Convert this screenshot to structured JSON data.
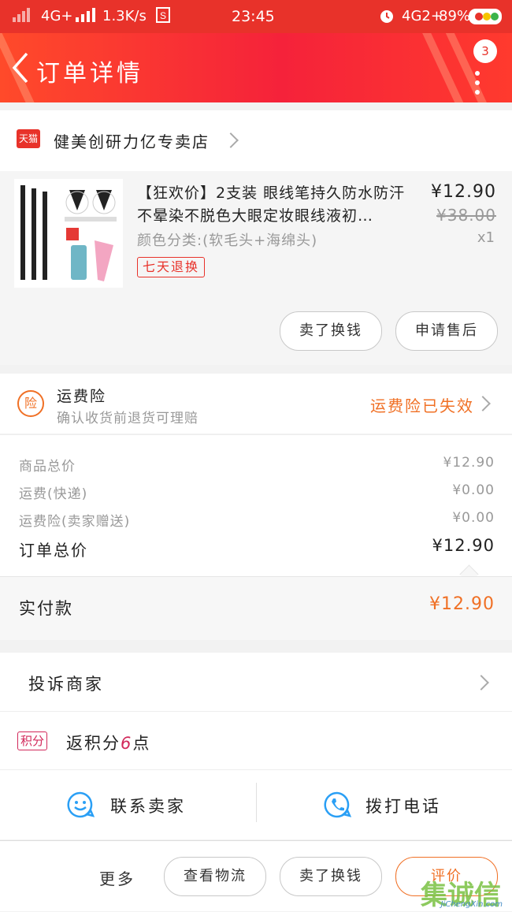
{
  "status_bar": {
    "network_left": "4G+",
    "speed": "1.3K/s",
    "time": "23:45",
    "network_right": "4G2+",
    "battery": "89%"
  },
  "nav": {
    "title": "订单详情",
    "badge_count": "3"
  },
  "shop": {
    "badge": "天猫",
    "name": "健美创研力亿专卖店"
  },
  "product": {
    "title": "【狂欢价】2支装 眼线笔持久防水防汗不晕染不脱色大眼定妆眼线液初…",
    "price": "¥12.90",
    "original_price": "¥38.00",
    "sku": "颜色分类:(软毛头+海绵头)",
    "quantity": "x1",
    "return_tag": "七天退换",
    "btn_refund": "卖了换钱",
    "btn_after_sale": "申请售后"
  },
  "insurance": {
    "icon_char": "险",
    "title": "运费险",
    "subtitle": "确认收货前退货可理赔",
    "status": "运费险已失效"
  },
  "fees": {
    "items": [
      {
        "label": "商品总价",
        "value": "¥12.90"
      },
      {
        "label": "运费(快递)",
        "value": "¥0.00"
      },
      {
        "label": "运费险(卖家赠送)",
        "value": "¥0.00"
      }
    ],
    "total_label": "订单总价",
    "total_value": "¥12.90"
  },
  "payment": {
    "label": "实付款",
    "value": "¥12.90"
  },
  "complaint": {
    "label": "投诉商家"
  },
  "points": {
    "tag": "积分",
    "prefix": "返积分",
    "amount": "6",
    "suffix": "点"
  },
  "contact": {
    "seller_label": "联系卖家",
    "phone_label": "拨打电话"
  },
  "bottom_bar": {
    "more_label": "更多",
    "btn_logistics": "查看物流",
    "btn_resell": "卖了换钱",
    "btn_review": "评价"
  },
  "watermark": {
    "brand": "集诚信",
    "site": "JiChengXin.com"
  },
  "colors": {
    "brand_red": "#e8322a",
    "accent_orange": "#f07025",
    "points_pink": "#d2285a"
  }
}
